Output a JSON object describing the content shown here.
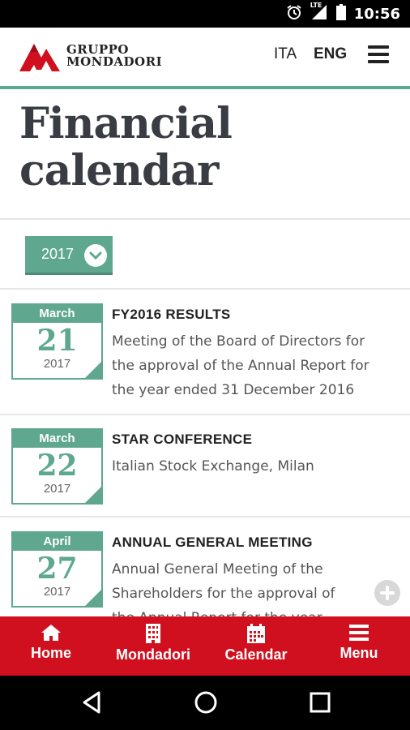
{
  "status_bar": {
    "time": "10:56",
    "icons": [
      "alarm-icon",
      "lte-signal-icon",
      "battery-icon"
    ],
    "lte_label": "LTE"
  },
  "header": {
    "logo_line1": "GRUPPO",
    "logo_line2": "MONDADORI",
    "lang_ita": "ITA",
    "lang_eng": "ENG",
    "accent_color": "#5fa88f"
  },
  "page": {
    "title_line1": "Financial",
    "title_line2": "calendar"
  },
  "year_select": {
    "value": "2017"
  },
  "events": [
    {
      "month": "March",
      "day": "21",
      "year": "2017",
      "title": "FY2016 RESULTS",
      "desc_lines": [
        "Meeting of the Board of Directors for",
        "the approval of the Annual Report for",
        "the year ended 31 December 2016"
      ]
    },
    {
      "month": "March",
      "day": "22",
      "year": "2017",
      "title": "STAR CONFERENCE",
      "desc_lines": [
        "Italian Stock Exchange, Milan"
      ]
    },
    {
      "month": "April",
      "day": "27",
      "year": "2017",
      "title": "ANNUAL GENERAL MEETING",
      "desc_lines": [
        "Annual General Meeting of the",
        "Shareholders for the approval of",
        "the Annual Report for the year"
      ]
    }
  ],
  "bottom_nav": {
    "color": "#d0101e",
    "items": [
      {
        "label": "Home",
        "icon": "home-icon"
      },
      {
        "label": "Mondadori",
        "icon": "building-icon"
      },
      {
        "label": "Calendar",
        "icon": "calendar-icon"
      },
      {
        "label": "Menu",
        "icon": "menu-icon"
      }
    ]
  },
  "system_nav": {
    "icons": [
      "back-icon",
      "home-circle-icon",
      "recents-icon"
    ]
  }
}
